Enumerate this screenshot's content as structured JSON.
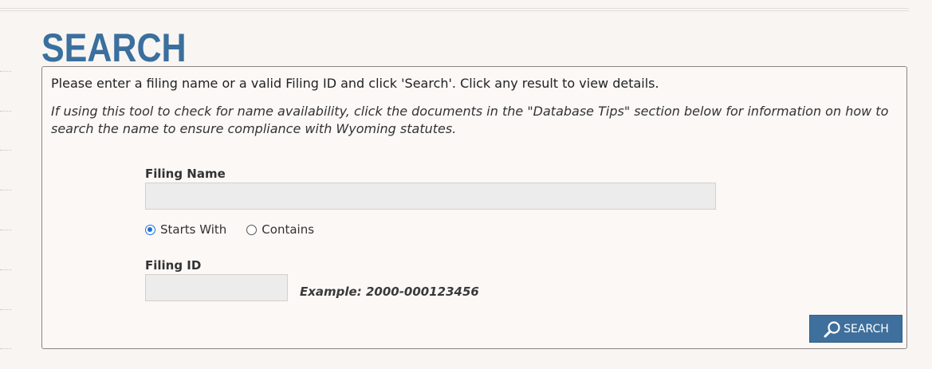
{
  "page": {
    "title": "SEARCH"
  },
  "panel": {
    "instructions": "Please enter a filing name or a valid Filing ID and click 'Search'. Click any result to view details.",
    "note": "If using this tool to check for name availability, click the documents in the \"Database Tips\" section below for information on how to search the name to ensure compliance with Wyoming statutes."
  },
  "filing_name": {
    "label": "Filing Name",
    "value": "",
    "placeholder": ""
  },
  "match_mode": {
    "options": [
      {
        "label": "Starts With",
        "checked": true
      },
      {
        "label": "Contains",
        "checked": false
      }
    ]
  },
  "filing_id": {
    "label": "Filing ID",
    "value": "",
    "placeholder": "",
    "example": "Example: 2000-000123456"
  },
  "search_button": {
    "label": "SEARCH",
    "icon": "search-icon"
  },
  "colors": {
    "title": "#3a6f9e",
    "button": "#3f6f9c",
    "background": "#f8f5f2",
    "radio_checked": "#1a6fe0"
  }
}
